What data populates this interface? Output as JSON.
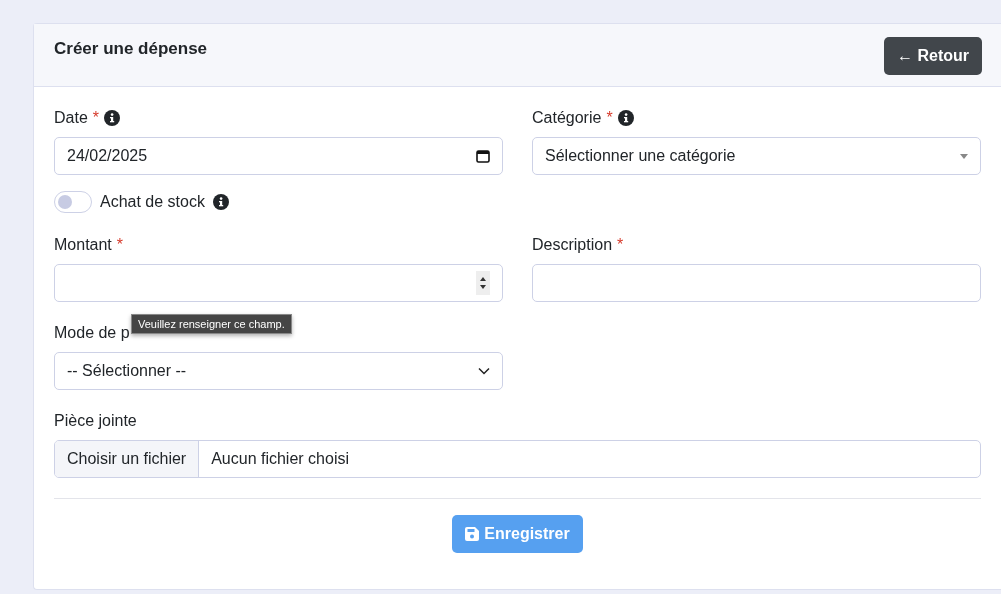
{
  "header": {
    "title": "Créer une dépense",
    "back_button": {
      "label": "← Retour"
    }
  },
  "rows": [
    {
      "fields": [
        {
          "kind": "date",
          "label": "Date",
          "required_mark": "*",
          "info": true,
          "value": "24/02/2025"
        },
        {
          "kind": "searchable_select",
          "label": "Catégorie",
          "required_mark": "*",
          "info": true,
          "value": "Sélectionner une catégorie"
        }
      ]
    },
    {
      "fields": [
        {
          "kind": "toggle",
          "label": "Achat de stock",
          "info": true,
          "on": false
        }
      ]
    },
    {
      "fields": [
        {
          "kind": "number",
          "label": "Montant",
          "required_mark": "*",
          "validation_message": "Veuillez renseigner ce champ."
        },
        {
          "kind": "text",
          "label": "Description",
          "required_mark": "*"
        }
      ]
    },
    {
      "fields": [
        {
          "kind": "select",
          "label": "Mode de p",
          "value": "-- Sélectionner --"
        }
      ]
    },
    {
      "fields": [
        {
          "kind": "file",
          "label": "Pièce jointe",
          "button": "Choisir un fichier",
          "value": "Aucun fichier choisi"
        }
      ]
    }
  ],
  "save_button": {
    "label": "Enregistrer",
    "disabled": true
  }
}
